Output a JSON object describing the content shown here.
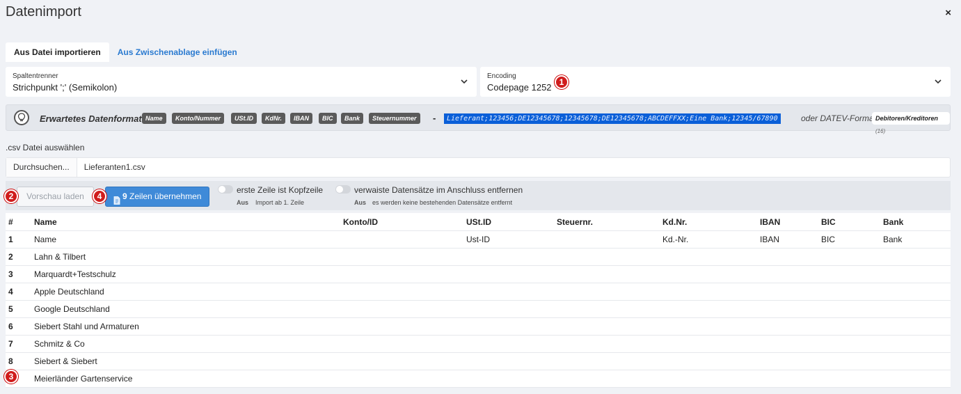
{
  "dialog": {
    "title": "Datenimport",
    "close_label": "×"
  },
  "tabs": [
    {
      "label": "Aus Datei importieren",
      "active": true
    },
    {
      "label": "Aus Zwischenablage einfügen",
      "active": false
    }
  ],
  "separator": {
    "label": "Spaltentrenner",
    "value": "Strichpunkt ';' (Semikolon)"
  },
  "encoding": {
    "label": "Encoding",
    "value": "Codepage 1252"
  },
  "format": {
    "expected_label": "Erwartetes Datenformat:",
    "fields": [
      "Name",
      "Konto/Nummer",
      "USt.ID",
      "KdNr.",
      "IBAN",
      "BIC",
      "Bank",
      "Steuernummer"
    ],
    "dash": "-",
    "sample": "Lieferant;123456;DE12345678;12345678;DE12345678;ABCDEFFXX;Eine Bank;12345/67890",
    "or_label": "oder DATEV-Format:",
    "datev_label": "Debitoren/Kreditoren",
    "datev_count": "(16)"
  },
  "file": {
    "label": ".csv Datei auswählen",
    "browse_label": "Durchsuchen...",
    "filename": "Lieferanten1.csv"
  },
  "actions": {
    "preview_label": "Vorschau laden",
    "take_count": "9",
    "take_label": "Zeilen übernehmen",
    "toggle_header": {
      "label": "erste Zeile ist Kopfzeile",
      "state": "Aus",
      "sub": "Import ab 1. Zeile"
    },
    "toggle_orphans": {
      "label": "verwaiste Datensätze im Anschluss entfernen",
      "state": "Aus",
      "sub": "es werden keine bestehenden Datensätze entfernt"
    }
  },
  "table": {
    "headers": [
      "#",
      "Name",
      "Konto/ID",
      "USt.ID",
      "Steuernr.",
      "Kd.Nr.",
      "IBAN",
      "BIC",
      "Bank"
    ],
    "rows": [
      [
        "1",
        "Name",
        "",
        "Ust-ID",
        "",
        "Kd.-Nr.",
        "IBAN",
        "BIC",
        "Bank"
      ],
      [
        "2",
        "Lahn & Tilbert",
        "",
        "",
        "",
        "",
        "",
        "",
        ""
      ],
      [
        "3",
        "Marquardt+Testschulz",
        "",
        "",
        "",
        "",
        "",
        "",
        ""
      ],
      [
        "4",
        "Apple Deutschland",
        "",
        "",
        "",
        "",
        "",
        "",
        ""
      ],
      [
        "5",
        "Google Deutschland",
        "",
        "",
        "",
        "",
        "",
        "",
        ""
      ],
      [
        "6",
        "Siebert Stahl und Armaturen",
        "",
        "",
        "",
        "",
        "",
        "",
        ""
      ],
      [
        "7",
        "Schmitz & Co",
        "",
        "",
        "",
        "",
        "",
        "",
        ""
      ],
      [
        "8",
        "Siebert & Siebert",
        "",
        "",
        "",
        "",
        "",
        "",
        ""
      ],
      [
        "",
        "Meierländer Gartenservice",
        "",
        "",
        "",
        "",
        "",
        "",
        ""
      ]
    ]
  },
  "callouts": [
    "1",
    "2",
    "3",
    "4"
  ],
  "colors": {
    "accent": "#2a7ad0",
    "primary_button": "#3f8ad8",
    "callout": "#d01c1c",
    "sample_highlight": "#0a5fd8"
  }
}
